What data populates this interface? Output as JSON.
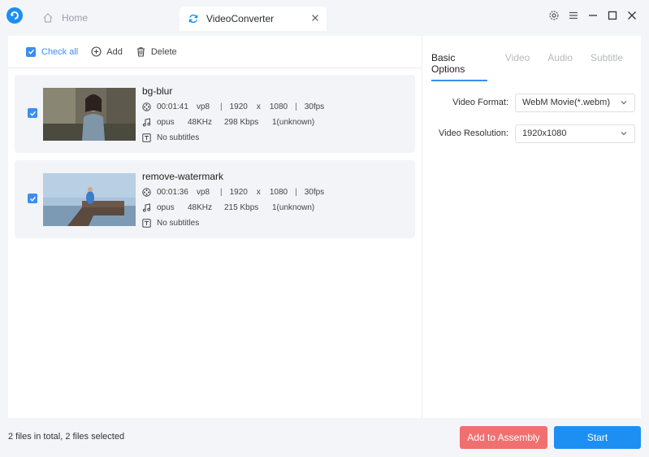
{
  "tabs": {
    "home": "Home",
    "video_converter": "VideoConverter"
  },
  "toolbar": {
    "check_all": "Check all",
    "add": "Add",
    "delete": "Delete"
  },
  "files": [
    {
      "name": "bg-blur",
      "duration": "00:01:41",
      "video_codec": "vp8",
      "width": "1920",
      "x": "x",
      "height": "1080",
      "fps": "30fps",
      "audio_codec": "opus",
      "sample_rate": "48KHz",
      "bitrate": "298 Kbps",
      "channels": "1(unknown)",
      "subtitles": "No subtitles"
    },
    {
      "name": "remove-watermark",
      "duration": "00:01:36",
      "video_codec": "vp8",
      "width": "1920",
      "x": "x",
      "height": "1080",
      "fps": "30fps",
      "audio_codec": "opus",
      "sample_rate": "48KHz",
      "bitrate": "215 Kbps",
      "channels": "1(unknown)",
      "subtitles": "No subtitles"
    }
  ],
  "options": {
    "tabs": [
      "Basic Options",
      "Video",
      "Audio",
      "Subtitle"
    ],
    "video_format_label": "Video Format:",
    "video_format_value": "WebM Movie(*.webm)",
    "video_resolution_label": "Video Resolution:",
    "video_resolution_value": "1920x1080"
  },
  "footer": {
    "status": "2 files in total, 2 files selected",
    "add_to_assembly": "Add to Assembly",
    "start": "Start"
  },
  "colors": {
    "accent": "#1d8ff2",
    "danger": "#f07070"
  }
}
